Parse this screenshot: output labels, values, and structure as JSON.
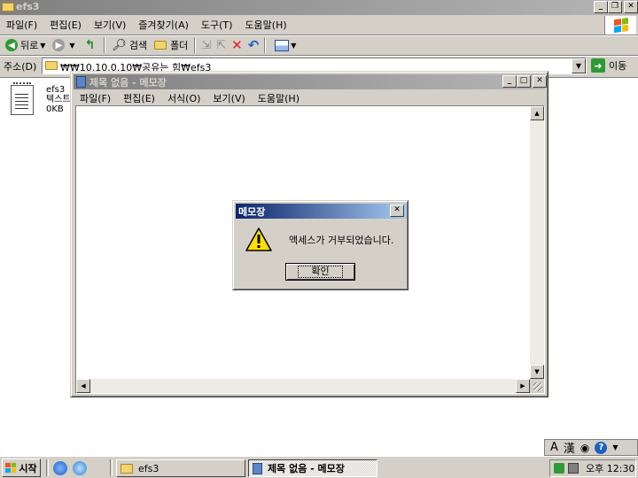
{
  "explorer": {
    "title": "efs3",
    "menu": [
      {
        "label": "파일(F)"
      },
      {
        "label": "편집(E)"
      },
      {
        "label": "보기(V)"
      },
      {
        "label": "즐겨찾기(A)"
      },
      {
        "label": "도구(T)"
      },
      {
        "label": "도움말(H)"
      }
    ],
    "toolbar": {
      "back_label": "뒤로",
      "search_label": "검색",
      "folders_label": "폴더"
    },
    "address": {
      "label": "주소(D)",
      "value": "₩₩10.10.0.10₩공유는 힘₩efs3",
      "go_label": "이동"
    },
    "file": {
      "name": "efs3",
      "type": "텍스트",
      "size": "0KB"
    },
    "ime": {
      "glyph_a": "A",
      "glyph_han": "漢",
      "help": "?"
    }
  },
  "notepad": {
    "title": "제목 없음 - 메모장",
    "menu": [
      {
        "label": "파일(F)"
      },
      {
        "label": "편집(E)"
      },
      {
        "label": "서식(O)"
      },
      {
        "label": "보기(V)"
      },
      {
        "label": "도움말(H)"
      }
    ]
  },
  "dialog": {
    "title": "메모장",
    "message": "액세스가 거부되었습니다.",
    "ok_label": "확인"
  },
  "taskbar": {
    "start_label": "시작",
    "tasks": [
      {
        "label": "efs3"
      },
      {
        "label": "제목 없음 - 메모장"
      }
    ],
    "clock": "오후 12:30"
  },
  "colors": {
    "active_title_start": "#0a246a",
    "active_title_end": "#a6caf0",
    "inactive_title_start": "#808080",
    "inactive_title_end": "#b5b5b5",
    "window_face": "#d4d0c8"
  }
}
